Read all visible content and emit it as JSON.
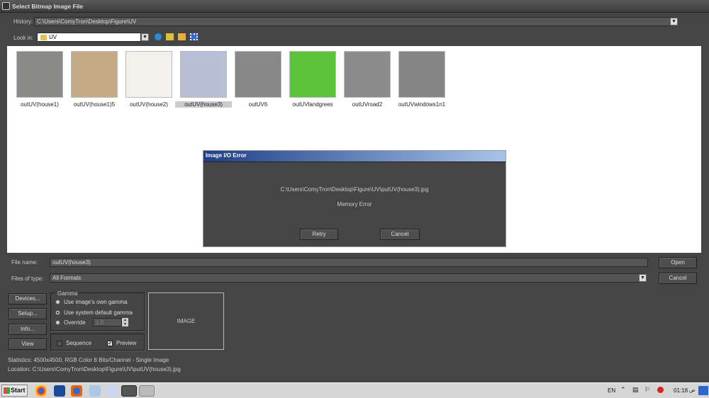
{
  "window": {
    "title": "Select Bitmap Image File"
  },
  "history": {
    "label": "History:",
    "value": "C:\\Users\\ComyTron\\Desktop\\Figure\\UV"
  },
  "lookin": {
    "label": "Look in:",
    "value": "UV"
  },
  "files": [
    {
      "name": "outUV(house1)",
      "color": "#8a8a88"
    },
    {
      "name": "outUV(house1)5",
      "color": "#c2ab86"
    },
    {
      "name": "outUV(house2)",
      "color": "#f4f1ec"
    },
    {
      "name": "outUV(house3)",
      "color": "#b9bfd6",
      "selected": true
    },
    {
      "name": "outUV6",
      "color": "#888888"
    },
    {
      "name": "outUVlandgrees",
      "color": "#5cc33a"
    },
    {
      "name": "outUVroad2",
      "color": "#8c8c8c"
    },
    {
      "name": "outUVwindows1n1",
      "color": "#858585"
    }
  ],
  "error_dialog": {
    "title": "Image I/O Error",
    "path": "C:\\Users\\ComyTron\\Desktop\\Figure\\UV\\putUV(house3).jpg",
    "message": "Memory Error",
    "retry": "Retry",
    "cancel": "Cancel"
  },
  "filename": {
    "label": "File name:",
    "value": "outUV(house3)"
  },
  "filetype": {
    "label": "Files of type:",
    "value": "All Formats"
  },
  "buttons": {
    "open": "Open",
    "cancel": "Cancel",
    "devices": "Devices...",
    "setup": "Setup...",
    "info": "Info...",
    "view": "View"
  },
  "gamma": {
    "title": "Gamma",
    "own": "Use image's own gamma",
    "system": "Use system default gamma",
    "override": "Override",
    "override_value": "1.0"
  },
  "sequence": "Sequence",
  "preview": "Preview",
  "image_label": "IMAGE",
  "statistics": "Statistics:  4500x4500, RGB Color 8 Bits/Channel - Single Image",
  "location": "Location:  C:\\Users\\ComyTron\\Desktop\\Figure\\UV\\putUV(house3).jpg",
  "taskbar": {
    "start": "Start",
    "lang": "EN",
    "time": "01:18",
    "ampm": "ص"
  }
}
